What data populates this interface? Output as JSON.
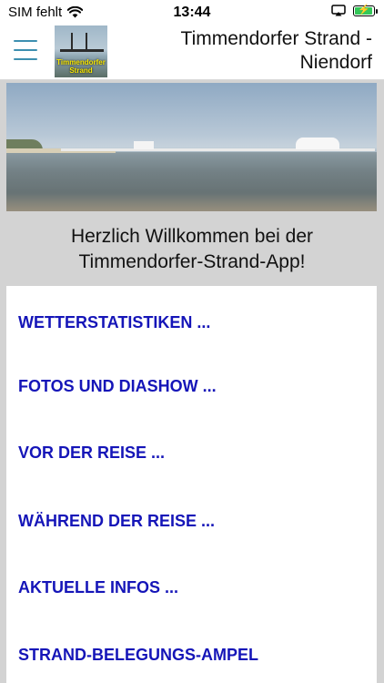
{
  "status_bar": {
    "carrier": "SIM fehlt",
    "time": "13:44"
  },
  "header": {
    "logo_text_line1": "Timmendorfer",
    "logo_text_line2": "Strand",
    "title": "Timmendorfer Strand - Niendorf"
  },
  "welcome": {
    "line1": "Herzlich Willkommen bei der",
    "line2": "Timmendorfer-Strand-App!"
  },
  "menu": {
    "items": [
      {
        "label": "WETTERSTATISTIKEN ..."
      },
      {
        "label": "FOTOS UND DIASHOW ..."
      },
      {
        "label": "VOR DER REISE ..."
      },
      {
        "label": "WÄHREND DER REISE ..."
      },
      {
        "label": "AKTUELLE INFOS ..."
      },
      {
        "label": "STRAND-BELEGUNGS-AMPEL"
      }
    ]
  },
  "colors": {
    "menu_link": "#1515b8",
    "hamburger": "#3d8fb0",
    "background_gray": "#d3d3d3",
    "battery_fill": "#34c759"
  },
  "icons": {
    "wifi": "wifi-icon",
    "screen_mirroring": "screen-mirroring-icon",
    "battery": "battery-charging-icon",
    "menu": "hamburger-menu-icon"
  }
}
